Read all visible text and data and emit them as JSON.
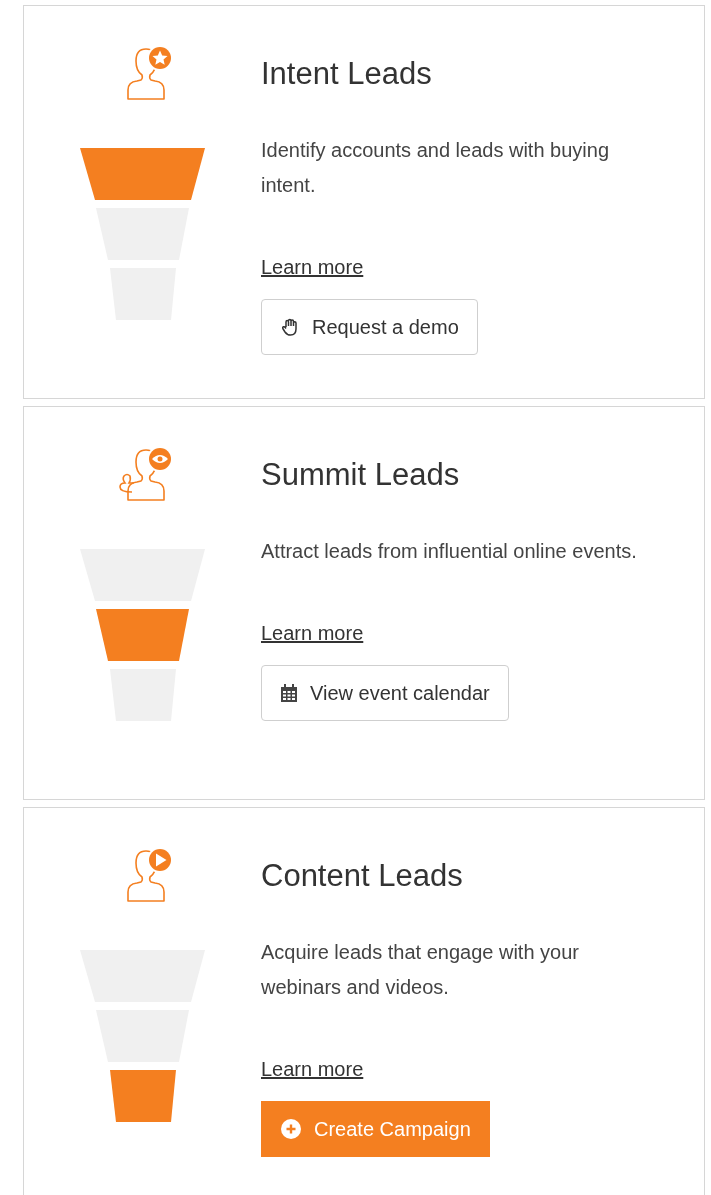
{
  "cards": [
    {
      "title": "Intent Leads",
      "description": "Identify accounts and leads with buying intent.",
      "link": "Learn more",
      "stages": [
        {
          "highlighted": true
        },
        {
          "highlighted": false
        },
        {
          "highlighted": false
        }
      ],
      "button": {
        "kind": "outline",
        "label": "Request a demo"
      }
    },
    {
      "title": "Summit Leads",
      "description": "Attract leads from influential online events.",
      "link": "Learn more",
      "stages": [
        {
          "highlighted": false
        },
        {
          "highlighted": true
        },
        {
          "highlighted": false
        }
      ],
      "button": {
        "kind": "outline",
        "label": "View event calendar"
      }
    },
    {
      "title": "Content Leads",
      "description": "Acquire leads that engage with your webinars and videos.",
      "link": "Learn more",
      "stages": [
        {
          "highlighted": false
        },
        {
          "highlighted": false
        },
        {
          "highlighted": true
        }
      ],
      "button": {
        "kind": "primary",
        "label": "Create Campaign"
      }
    }
  ]
}
